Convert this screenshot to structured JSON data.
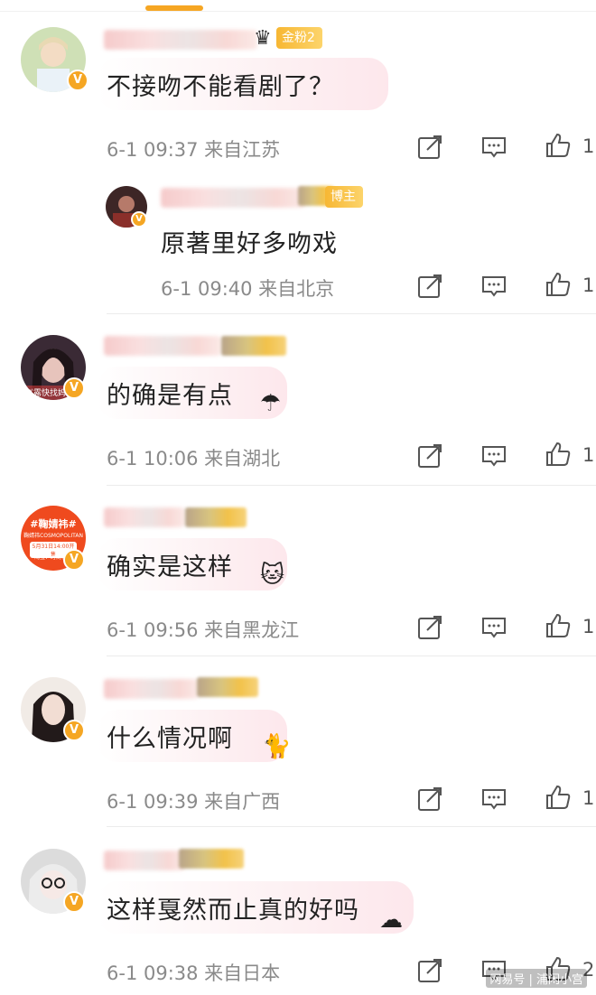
{
  "comments": [
    {
      "text": "不接吻不能看剧了？",
      "meta": "6-1 09:37 来自江苏",
      "like_count": "1",
      "fan_badge": "金粉2",
      "avatar_colors": [
        "#d6e6c4",
        "#8fb36a"
      ]
    },
    {
      "text": "原著里好多吻戏",
      "meta": "6-1 09:40 来自北京",
      "like_count": "1",
      "role_badge": "博主",
      "avatar_colors": [
        "#6b3a3a",
        "#2b1a1a"
      ]
    },
    {
      "text": "的确是有点",
      "meta": "6-1 10:06 来自湖北",
      "like_count": "1",
      "avatar_caption": "赵露快找妈",
      "avatar_colors": [
        "#3a2a35",
        "#c9a0a0"
      ]
    },
    {
      "text": "确实是这样",
      "meta": "6-1 09:56 来自黑龙江",
      "like_count": "1",
      "avatar_tag": "#鞠婧祎#",
      "avatar_sub1": "鞠婧祎COSMOPOLITAN",
      "avatar_sub2": "5月31日14:00开售",
      "avatar_sub3": "淘宝：时尚传媒",
      "avatar_colors": [
        "#ef4a1e",
        "#f2702a"
      ]
    },
    {
      "text": "什么情况啊",
      "meta": "6-1 09:39 来自广西",
      "like_count": "1",
      "avatar_colors": [
        "#f3ece8",
        "#2a2020"
      ]
    },
    {
      "text": "这样戛然而止真的好吗",
      "meta": "6-1 09:38 来自日本",
      "like_count": "2",
      "avatar_colors": [
        "#dcdcdc",
        "#a9a9b0"
      ]
    }
  ],
  "icons": {
    "share": "share-icon",
    "comment": "comment-icon",
    "like": "thumbs-up-icon",
    "verified": "verified-badge-icon"
  },
  "verified_mark": "V",
  "watermark": "网易号 | 浦闲小宫",
  "colors": {
    "accent": "#f6a623",
    "meta_text": "#8a8a8a"
  }
}
